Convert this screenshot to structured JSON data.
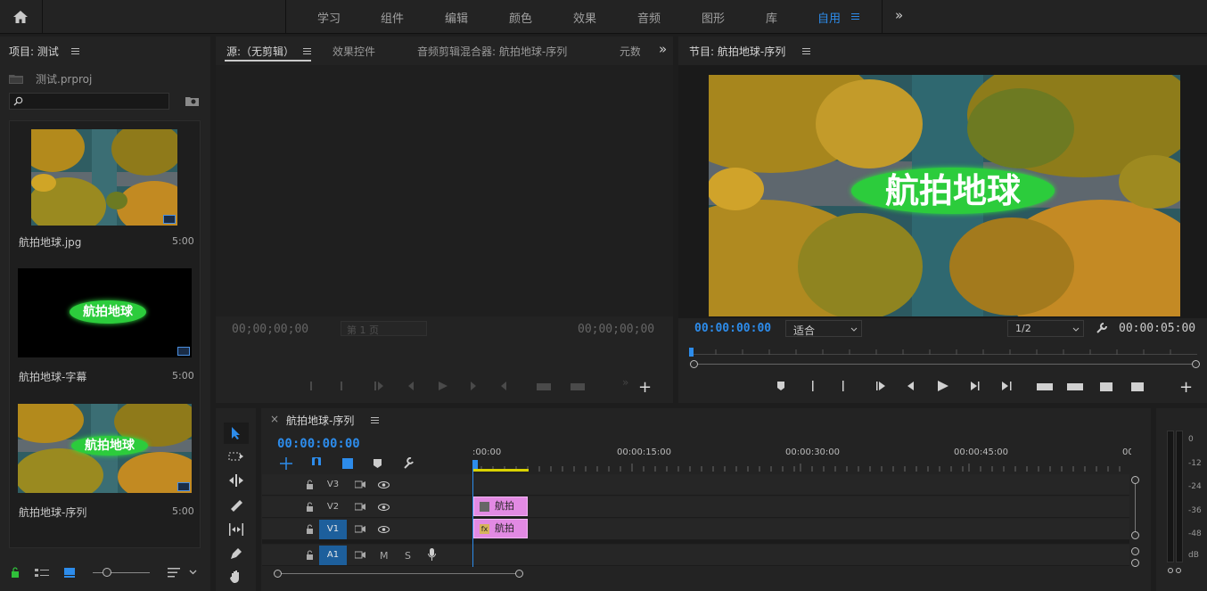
{
  "topbar": {
    "workspaces": [
      "学习",
      "组件",
      "编辑",
      "颜色",
      "效果",
      "音频",
      "图形",
      "库",
      "自用"
    ],
    "active": "自用",
    "more": "»"
  },
  "project": {
    "title": "项目: 测试",
    "file": "测试.prproj",
    "search_placeholder": "",
    "items": [
      {
        "name": "航拍地球.jpg",
        "duration": "5:00",
        "overlay": ""
      },
      {
        "name": "航拍地球-字幕",
        "duration": "5:00",
        "overlay": "航拍地球"
      },
      {
        "name": "航拍地球-序列",
        "duration": "5:00",
        "overlay": "航拍地球"
      }
    ]
  },
  "source": {
    "tabs": [
      "源:（无剪辑）",
      "效果控件",
      "音频剪辑混合器: 航拍地球-序列",
      "元数"
    ],
    "more": "»",
    "tc_left": "00;00;00;00",
    "page": "第 1 页",
    "tc_right": "00;00;00;00"
  },
  "program": {
    "title": "节目: 航拍地球-序列",
    "overlay": "航拍地球",
    "tc_current": "00:00:00:00",
    "fit": "适合",
    "resolution": "1/2",
    "tc_duration": "00:00:05:00"
  },
  "timeline": {
    "title": "航拍地球-序列",
    "close": "×",
    "timecode": "00:00:00:00",
    "ruler": [
      ":00:00",
      "00:00:15:00",
      "00:00:30:00",
      "00:00:45:00",
      "00:"
    ],
    "tracks": [
      {
        "label": "V3",
        "selected": false
      },
      {
        "label": "V2",
        "selected": false
      },
      {
        "label": "V1",
        "selected": true
      },
      {
        "label": "A1",
        "selected": true
      }
    ],
    "clips": [
      {
        "track": "V2",
        "label": "航拍"
      },
      {
        "track": "V1",
        "label": "航拍",
        "badge": "fx"
      }
    ],
    "audio_buttons": [
      "M",
      "S"
    ]
  },
  "meter": {
    "scale": [
      "0",
      "-12",
      "-24",
      "-36",
      "-48",
      "dB"
    ]
  },
  "colors": {
    "accent": "#2d8ceb",
    "clip": "#e28ae3",
    "title_pill": "#2ccc3c",
    "selected_track": "#1d5f9c"
  }
}
